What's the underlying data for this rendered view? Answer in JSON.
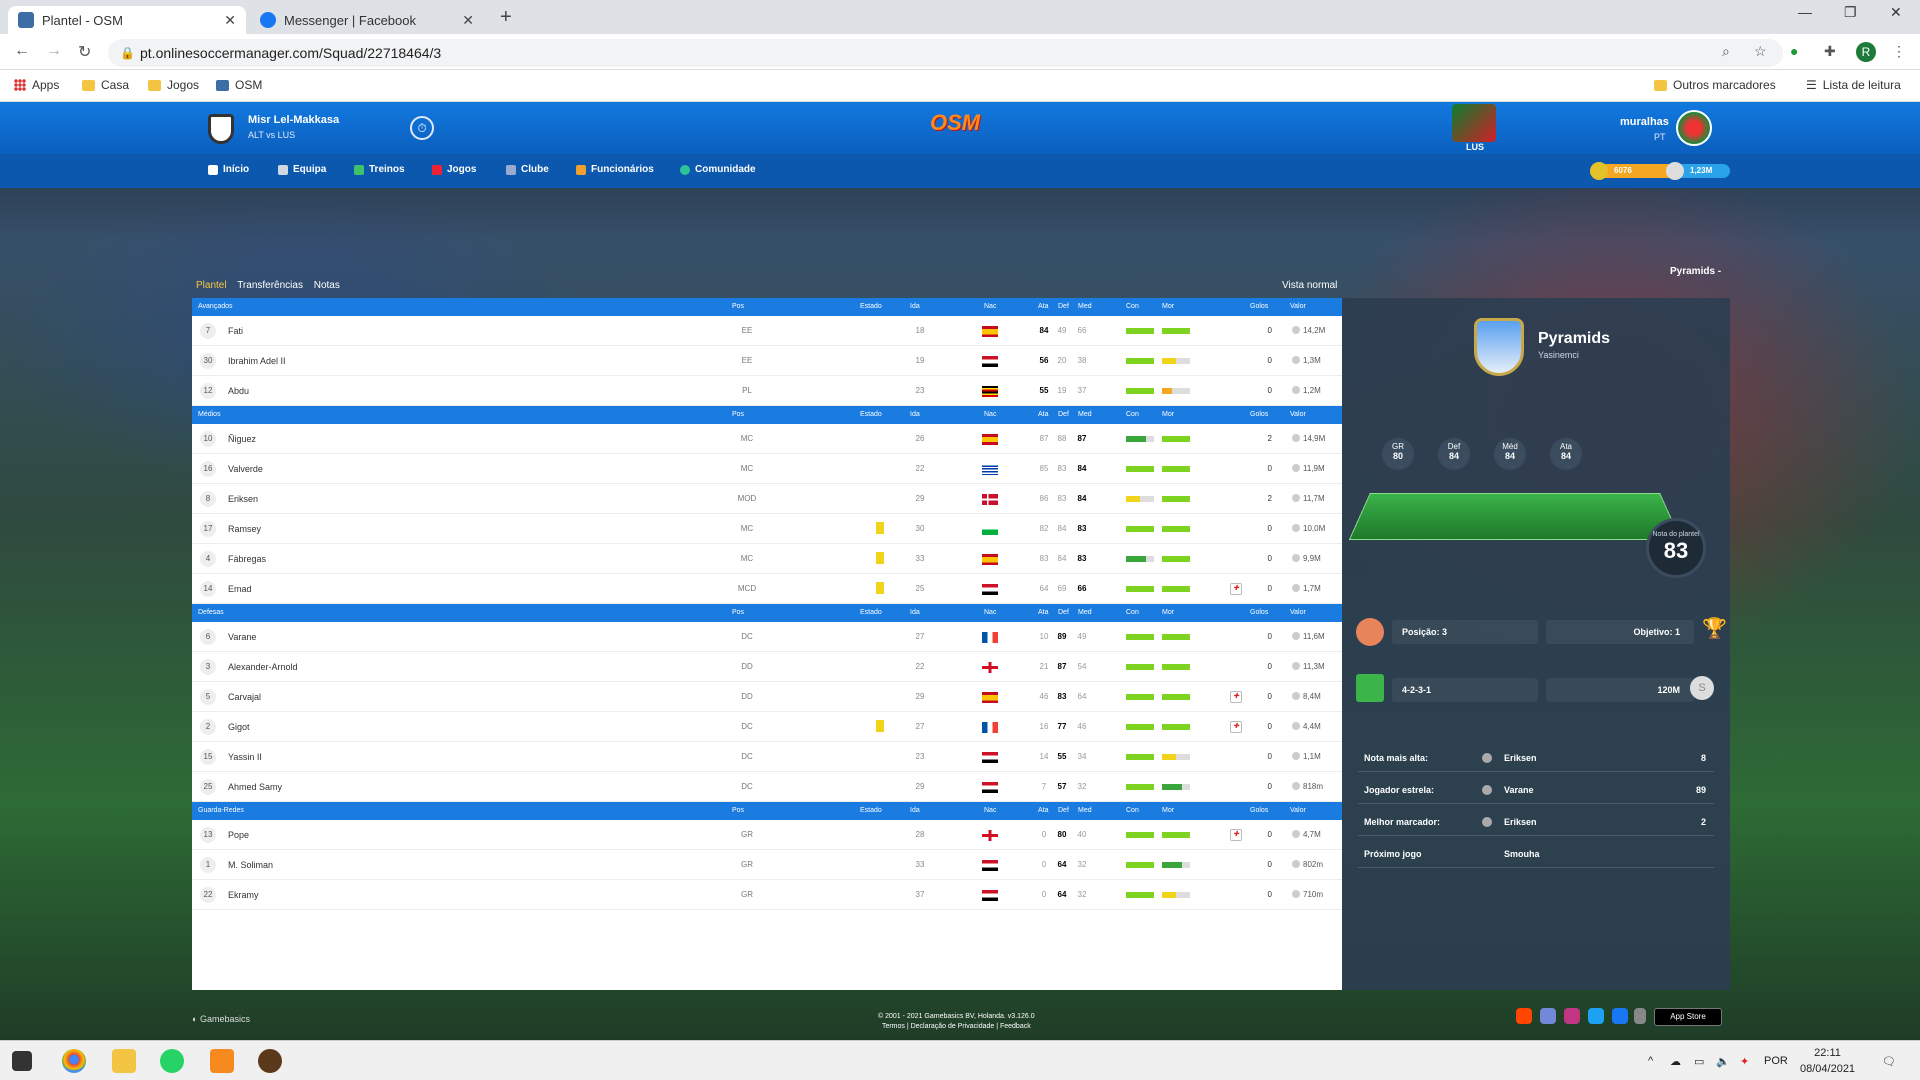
{
  "browser": {
    "tabs": [
      {
        "title": "Plantel - OSM",
        "active": true
      },
      {
        "title": "Messenger | Facebook",
        "active": false
      }
    ],
    "url": "pt.onlinesoccermanager.com/Squad/22718464/3",
    "bookmarks": [
      "Apps",
      "Casa",
      "Jogos",
      "OSM"
    ],
    "other_bookmarks": "Outros marcadores",
    "reading_list": "Lista de leitura",
    "profile_initial": "R"
  },
  "header": {
    "club_name": "Misr Lel-Makkasa",
    "club_sub": "ALT vs LUS",
    "logo": "OSM",
    "league_flag_label": "LUS",
    "user_name": "muralhas",
    "user_country": "PT",
    "coins": "6076",
    "money": "1,23M"
  },
  "menu": [
    "Início",
    "Equipa",
    "Treinos",
    "Jogos",
    "Clube",
    "Funcionários",
    "Comunidade"
  ],
  "subtabs": [
    "Plantel",
    "Transferências",
    "Notas"
  ],
  "vista": "Vista normal",
  "team_dropdown": "Pyramids -",
  "columns": {
    "pos": "Pos",
    "estado": "Estado",
    "ida": "Ida",
    "nac": "Nac",
    "ata": "Ata",
    "def": "Def",
    "med": "Med",
    "con": "Con",
    "mor": "Mor",
    "golos": "Golos",
    "valor": "Valor"
  },
  "sections": [
    {
      "name": "Avançados",
      "players": [
        {
          "n": "7",
          "name": "Fati",
          "pos": "EE",
          "age": "18",
          "flag": "es",
          "ata": "84",
          "def": "49",
          "med": "66",
          "hi": "ata",
          "con": 1,
          "mor": 1,
          "card": false,
          "inj": false,
          "goals": "0",
          "value": "14,2M"
        },
        {
          "n": "30",
          "name": "Ibrahim Adel II",
          "pos": "EE",
          "age": "19",
          "flag": "eg",
          "ata": "56",
          "def": "20",
          "med": "38",
          "hi": "ata",
          "con": 1,
          "mor": 0.5,
          "card": false,
          "inj": false,
          "goals": "0",
          "value": "1,3M"
        },
        {
          "n": "12",
          "name": "Abdu",
          "pos": "PL",
          "age": "23",
          "flag": "ug",
          "ata": "55",
          "def": "19",
          "med": "37",
          "hi": "ata",
          "con": 1,
          "mor": 0.35,
          "card": false,
          "inj": false,
          "goals": "0",
          "value": "1,2M"
        }
      ]
    },
    {
      "name": "Médios",
      "players": [
        {
          "n": "10",
          "name": "Ñiguez",
          "pos": "MC",
          "age": "26",
          "flag": "es",
          "ata": "87",
          "def": "88",
          "med": "87",
          "hi": "med",
          "con": 0.7,
          "mor": 1,
          "card": false,
          "inj": false,
          "goals": "2",
          "value": "14,9M"
        },
        {
          "n": "16",
          "name": "Valverde",
          "pos": "MC",
          "age": "22",
          "flag": "uy",
          "ata": "85",
          "def": "83",
          "med": "84",
          "hi": "med",
          "con": 1,
          "mor": 1,
          "card": false,
          "inj": false,
          "goals": "0",
          "value": "11,9M"
        },
        {
          "n": "8",
          "name": "Eriksen",
          "pos": "MOD",
          "age": "29",
          "flag": "dk",
          "ata": "86",
          "def": "83",
          "med": "84",
          "hi": "med",
          "con": 0.5,
          "mor": 1,
          "card": false,
          "inj": false,
          "goals": "2",
          "value": "11,7M"
        },
        {
          "n": "17",
          "name": "Ramsey",
          "pos": "MC",
          "age": "30",
          "flag": "wa",
          "ata": "82",
          "def": "84",
          "med": "83",
          "hi": "med",
          "con": 1,
          "mor": 1,
          "card": true,
          "inj": false,
          "goals": "0",
          "value": "10,0M"
        },
        {
          "n": "4",
          "name": "Fàbregas",
          "pos": "MC",
          "age": "33",
          "flag": "es",
          "ata": "83",
          "def": "84",
          "med": "83",
          "hi": "med",
          "con": 0.7,
          "mor": 1,
          "card": true,
          "inj": false,
          "goals": "0",
          "value": "9,9M"
        },
        {
          "n": "14",
          "name": "Emad",
          "pos": "MCD",
          "age": "25",
          "flag": "eg",
          "ata": "64",
          "def": "69",
          "med": "66",
          "hi": "med",
          "con": 1,
          "mor": 1,
          "card": true,
          "inj": true,
          "goals": "0",
          "value": "1,7M"
        }
      ]
    },
    {
      "name": "Defesas",
      "players": [
        {
          "n": "6",
          "name": "Varane",
          "pos": "DC",
          "age": "27",
          "flag": "fr",
          "ata": "10",
          "def": "89",
          "med": "49",
          "hi": "def",
          "con": 1,
          "mor": 1,
          "card": false,
          "inj": false,
          "goals": "0",
          "value": "11,6M"
        },
        {
          "n": "3",
          "name": "Alexander-Arnold",
          "pos": "DD",
          "age": "22",
          "flag": "en",
          "ata": "21",
          "def": "87",
          "med": "54",
          "hi": "def",
          "con": 1,
          "mor": 1,
          "card": false,
          "inj": false,
          "goals": "0",
          "value": "11,3M"
        },
        {
          "n": "5",
          "name": "Carvajal",
          "pos": "DD",
          "age": "29",
          "flag": "es",
          "ata": "46",
          "def": "83",
          "med": "64",
          "hi": "def",
          "con": 1,
          "mor": 1,
          "card": false,
          "inj": true,
          "goals": "0",
          "value": "8,4M"
        },
        {
          "n": "2",
          "name": "Gigot",
          "pos": "DC",
          "age": "27",
          "flag": "fr",
          "ata": "16",
          "def": "77",
          "med": "46",
          "hi": "def",
          "con": 1,
          "mor": 1,
          "card": true,
          "inj": true,
          "goals": "0",
          "value": "4,4M"
        },
        {
          "n": "15",
          "name": "Yassin II",
          "pos": "DC",
          "age": "23",
          "flag": "eg",
          "ata": "14",
          "def": "55",
          "med": "34",
          "hi": "def",
          "con": 1,
          "mor": 0.5,
          "card": false,
          "inj": false,
          "goals": "0",
          "value": "1,1M"
        },
        {
          "n": "25",
          "name": "Ahmed Samy",
          "pos": "DC",
          "age": "29",
          "flag": "eg",
          "ata": "7",
          "def": "57",
          "med": "32",
          "hi": "def",
          "con": 1,
          "mor": 0.7,
          "card": false,
          "inj": false,
          "goals": "0",
          "value": "818m"
        }
      ]
    },
    {
      "name": "Guarda-Redes",
      "players": [
        {
          "n": "13",
          "name": "Pope",
          "pos": "GR",
          "age": "28",
          "flag": "en",
          "ata": "0",
          "def": "80",
          "med": "40",
          "hi": "def",
          "con": 1,
          "mor": 1,
          "card": false,
          "inj": true,
          "goals": "0",
          "value": "4,7M"
        },
        {
          "n": "1",
          "name": "M. Soliman",
          "pos": "GR",
          "age": "33",
          "flag": "eg",
          "ata": "0",
          "def": "64",
          "med": "32",
          "hi": "def",
          "con": 1,
          "mor": 0.7,
          "card": false,
          "inj": false,
          "goals": "0",
          "value": "802m"
        },
        {
          "n": "22",
          "name": "Ekramy",
          "pos": "GR",
          "age": "37",
          "flag": "eg",
          "ata": "0",
          "def": "64",
          "med": "32",
          "hi": "def",
          "con": 1,
          "mor": 0.5,
          "card": false,
          "inj": false,
          "goals": "0",
          "value": "710m"
        }
      ]
    }
  ],
  "side": {
    "team": "Pyramids",
    "sub": "Yasinemci",
    "stats": [
      {
        "l": "GR",
        "v": "80"
      },
      {
        "l": "Def",
        "v": "84"
      },
      {
        "l": "Méd",
        "v": "84"
      },
      {
        "l": "Ata",
        "v": "84"
      }
    ],
    "rating_label": "Nota do plantel",
    "rating": "83",
    "position": "Posição: 3",
    "objective": "Objetivo: 1",
    "formation": "4-2-3-1",
    "budget": "120M",
    "list": [
      {
        "label": "Nota mais alta:",
        "player": "Eriksen",
        "val": "8"
      },
      {
        "label": "Jogador estrela:",
        "player": "Varane",
        "val": "89"
      },
      {
        "label": "Melhor marcador:",
        "player": "Eriksen",
        "val": "2"
      },
      {
        "label": "Próximo jogo",
        "player": "Smouha",
        "val": ""
      }
    ]
  },
  "footer": {
    "brand": "Gamebasics",
    "copyright": "© 2001 - 2021 Gamebasics BV, Holanda. v3.126.0",
    "links": "Termos | Declaração de Privacidade | Feedback",
    "appstore": "App Store"
  },
  "taskbar": {
    "lang": "POR",
    "time": "22:11",
    "date": "08/04/2021"
  },
  "colors": {
    "green": "#7ed321",
    "dark_green": "#3aa53a",
    "yellow": "#f2d31b",
    "orange": "#f5a623",
    "accent": "#1a7be0"
  }
}
